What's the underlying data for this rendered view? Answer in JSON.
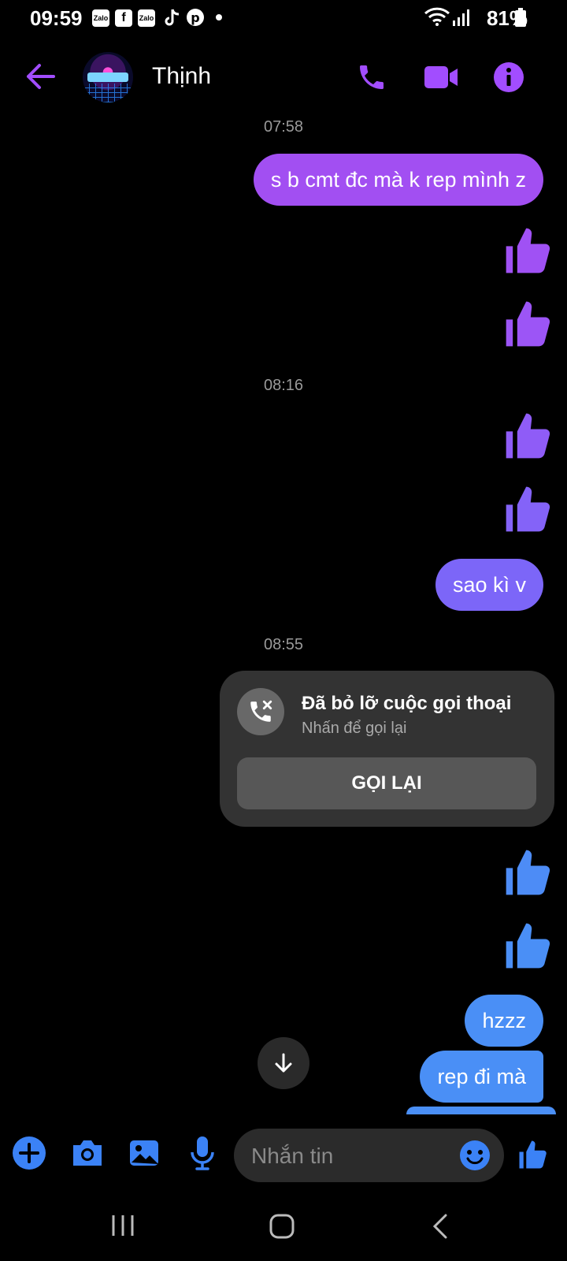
{
  "status_bar": {
    "time": "09:59",
    "notification_icons": [
      "zalo-icon",
      "facebook-icon",
      "zalo-icon",
      "tiktok-icon",
      "pinterest-icon",
      "dot-icon"
    ],
    "battery": "81%"
  },
  "header": {
    "contact_name": "Thịnh",
    "accent_color": "#a24dff"
  },
  "messages": {
    "timestamp_1": "07:58",
    "msg_1": "s b cmt đc mà  k rep mình z",
    "timestamp_2": "08:16",
    "msg_2": "sao kì v",
    "timestamp_3": "08:55",
    "msg_3": "hzzz",
    "msg_4": "rep đi mà"
  },
  "missed_call": {
    "title": "Đã bỏ lỡ cuộc gọi thoại",
    "subtitle": "Nhấn để gọi lại",
    "button_label": "GỌI LẠI"
  },
  "composer": {
    "placeholder": "Nhắn tin",
    "accent_color": "#3b82f6"
  }
}
